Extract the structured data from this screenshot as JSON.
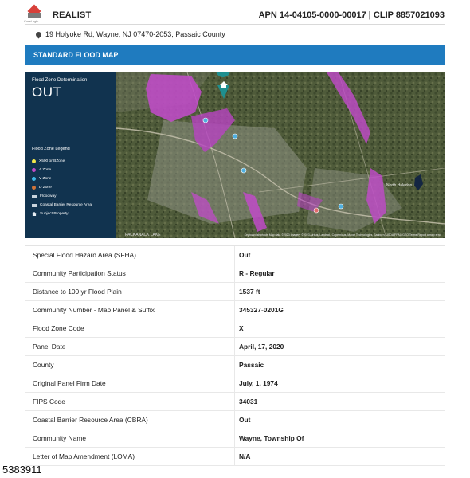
{
  "header": {
    "brand": "REALIST",
    "logo_text": "CoreLogic",
    "apn_clip": "APN 14-04105-0000-00017 | CLIP 8857021093"
  },
  "address": "19 Holyoke Rd, Wayne, NJ 07470-2053, Passaic County",
  "section_title": "STANDARD FLOOD MAP",
  "flood_panel": {
    "determination_label": "Flood Zone Determination",
    "determination_value": "OUT",
    "legend_title": "Flood Zone Legend",
    "legend_items": [
      {
        "label": "X500 or BZone",
        "color": "#f3e74a",
        "icon": "dot"
      },
      {
        "label": "A Zone",
        "color": "#c04bc8",
        "icon": "dot"
      },
      {
        "label": "V Zone",
        "color": "#3fb6e6",
        "icon": "dot"
      },
      {
        "label": "D Zone",
        "color": "#d0743a",
        "icon": "dot"
      },
      {
        "label": "Floodway",
        "color": "#c9d3dc",
        "icon": "rect"
      },
      {
        "label": "Coastal Barrier Resource Area",
        "color": "#c9d3dc",
        "icon": "rect"
      },
      {
        "label": "Subject Property",
        "color": "#e8eef3",
        "icon": "house-icon"
      }
    ]
  },
  "map": {
    "attribution": "Keyboard shortcuts   Map data ©2023 Imagery ©2023 Airbus, Landsat / Copernicus, Maxar Technologies, Sanborn, USDA/FPAC/GEO   Terms   Report a map error",
    "labels": {
      "packanack": "PACKANACK LAKE",
      "haledon": "North Haledon"
    }
  },
  "details": [
    {
      "label": "Special Flood Hazard Area (SFHA)",
      "value": "Out"
    },
    {
      "label": "Community Participation Status",
      "value": "R - Regular"
    },
    {
      "label": "Distance to 100 yr Flood Plain",
      "value": "1537 ft"
    },
    {
      "label": "Community Number - Map Panel & Suffix",
      "value": "345327-0201G"
    },
    {
      "label": "Flood Zone Code",
      "value": "X"
    },
    {
      "label": "Panel Date",
      "value": "April, 17, 2020"
    },
    {
      "label": "County",
      "value": "Passaic"
    },
    {
      "label": "Original Panel Firm Date",
      "value": "July, 1, 1974"
    },
    {
      "label": "FIPS Code",
      "value": "34031"
    },
    {
      "label": "Coastal Barrier Resource Area (CBRA)",
      "value": "Out"
    },
    {
      "label": "Community Name",
      "value": "Wayne, Township Of"
    },
    {
      "label": "Letter of Map Amendment (LOMA)",
      "value": "N/A"
    }
  ],
  "footer_id": "5383911",
  "colors": {
    "accent_bar": "#1f7bbf",
    "panel_bg": "#11334f",
    "flood_zone_a": "#c04bc8"
  }
}
